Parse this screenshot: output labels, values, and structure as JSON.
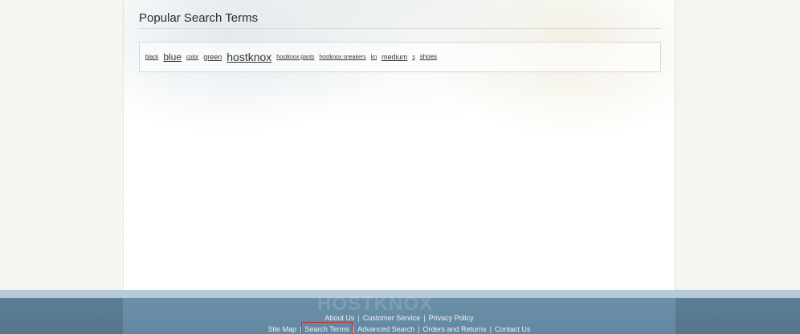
{
  "page": {
    "title": "Popular Search Terms"
  },
  "search_terms": [
    {
      "label": "black",
      "size": "s1"
    },
    {
      "label": "blue",
      "size": "s4"
    },
    {
      "label": "color",
      "size": "s1"
    },
    {
      "label": "green",
      "size": "s3"
    },
    {
      "label": "hostknox",
      "size": "s5"
    },
    {
      "label": "hostknox pants",
      "size": "s1"
    },
    {
      "label": "hostknox sneakers",
      "size": "s1"
    },
    {
      "label": "kn",
      "size": "s1"
    },
    {
      "label": "medium",
      "size": "s3"
    },
    {
      "label": "s",
      "size": "s1"
    },
    {
      "label": "shoes",
      "size": "s2"
    }
  ],
  "footer": {
    "watermark": "HOSTKNOX",
    "row1": [
      "About Us",
      "Customer Service",
      "Privacy Policy"
    ],
    "row2": [
      "Site Map",
      "Search Terms",
      "Advanced Search",
      "Orders and Returns",
      "Contact Us"
    ],
    "highlighted": "Search Terms",
    "separator": "|"
  },
  "colors": {
    "footer_dark": "#557689",
    "footer_light": "#b5cbd9",
    "highlight_box": "#c2342e"
  }
}
